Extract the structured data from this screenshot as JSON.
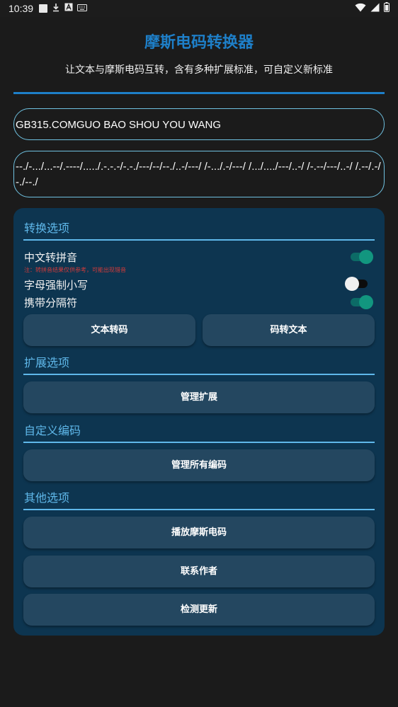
{
  "status_bar": {
    "time": "10:39",
    "left_icons": [
      "notification-square-icon",
      "download-icon",
      "font-a-icon",
      "keyboard-icon"
    ],
    "right_icons": [
      "wifi-icon",
      "signal-icon",
      "battery-icon"
    ]
  },
  "header": {
    "title": "摩斯电码转换器",
    "subtitle": "让文本与摩斯电码互转，含有多种扩展标准，可自定义新标准"
  },
  "input": {
    "value": "GB315.COMGUO BAO SHOU YOU WANG"
  },
  "output": {
    "value": "--./-.../...--/.----/...../.-.-.-/-.-./---/--/--./..-/---/ /-.../.-/---/ /.../..../---/..-/ /-.--/---/..-/ /.--/.-/-./--./"
  },
  "conversion": {
    "title": "转换选项",
    "options": [
      {
        "label": "中文转拼音",
        "enabled": true
      },
      {
        "label": "字母强制小写",
        "enabled": false
      },
      {
        "label": "携带分隔符",
        "enabled": true
      }
    ],
    "note": "注：转拼音结果仅供参考，可能出现错音",
    "encode_button": "文本转码",
    "decode_button": "码转文本"
  },
  "extension": {
    "title": "扩展选项",
    "manage_button": "管理扩展"
  },
  "custom": {
    "title": "自定义编码",
    "manage_button": "管理所有编码"
  },
  "other": {
    "title": "其他选项",
    "play_button": "播放摩斯电码",
    "contact_button": "联系作者",
    "update_button": "检测更新"
  },
  "colors": {
    "accent": "#1e7fc8",
    "section": "#5fb8ea",
    "card": "#0d3550",
    "button": "#244760",
    "switch_on": "#12967f",
    "note": "#d23a3a"
  }
}
